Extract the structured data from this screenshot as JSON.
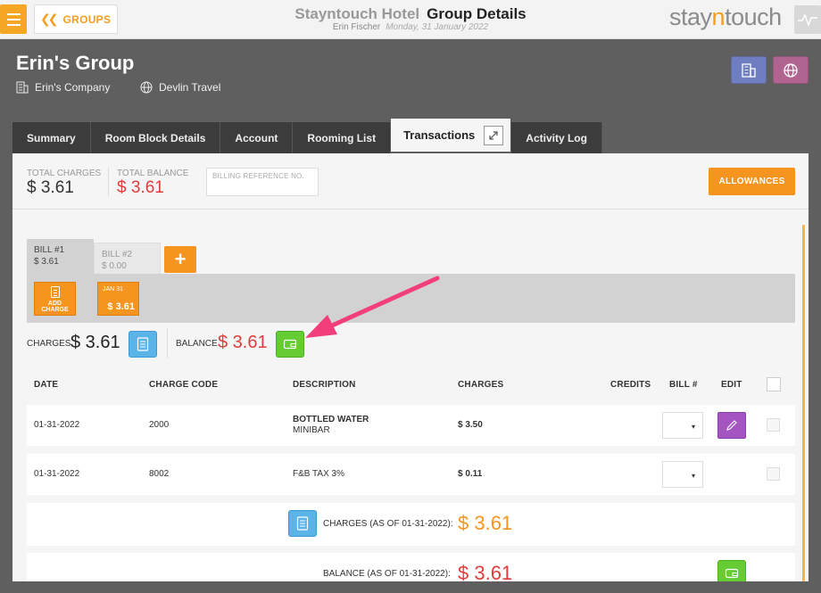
{
  "topbar": {
    "menu_icon": "hamburger-icon",
    "back_label": "GROUPS",
    "hotel_name": "Stayntouch Hotel",
    "page_title": "Group Details",
    "user_name": "Erin Fischer",
    "business_date": "Monday, 31 January 2022",
    "logo_prefix": "stay",
    "logo_n": "n",
    "logo_suffix": "touch"
  },
  "group": {
    "name": "Erin's Group",
    "company": "Erin's Company",
    "travel_agent": "Devlin Travel"
  },
  "tabs": [
    {
      "label": "Summary"
    },
    {
      "label": "Room Block Details"
    },
    {
      "label": "Account"
    },
    {
      "label": "Rooming List"
    },
    {
      "label": "Transactions",
      "active": true
    },
    {
      "label": "Activity Log"
    }
  ],
  "totals": {
    "total_charges_label": "TOTAL CHARGES",
    "total_charges_value": "$ 3.61",
    "total_balance_label": "TOTAL BALANCE",
    "total_balance_value": "$ 3.61",
    "billing_ref_placeholder": "BILLING REFERENCE NO.",
    "allowances_label": "ALLOWANCES"
  },
  "bills": [
    {
      "label": "BILL #1",
      "amount": "$ 3.61",
      "active": true
    },
    {
      "label": "BILL #2",
      "amount": "$ 0.00",
      "active": false
    }
  ],
  "add_bill_label": "+",
  "add_charge_label": "ADD CHARGE",
  "date_card": {
    "date": "JAN 31",
    "amount": "$ 3.61"
  },
  "summary": {
    "charges_label": "CHARGES",
    "charges_value": "$ 3.61",
    "balance_label": "BALANCE",
    "balance_value": "$ 3.61"
  },
  "table": {
    "headers": {
      "date": "DATE",
      "charge_code": "CHARGE CODE",
      "description": "DESCRIPTION",
      "charges": "CHARGES",
      "credits": "CREDITS",
      "bill_no": "BILL #",
      "edit": "EDIT"
    },
    "rows": [
      {
        "date": "01-31-2022",
        "code": "2000",
        "description": "BOTTLED WATER",
        "sub": "MINIBAR",
        "charge": "$ 3.50",
        "select": "▾"
      },
      {
        "date": "01-31-2022",
        "code": "8002",
        "description": "F&B TAX 3%",
        "sub": "",
        "charge": "$ 0.11",
        "select": "▾"
      }
    ]
  },
  "footer": {
    "charges_label": "CHARGES (AS OF 01-31-2022):",
    "charges_value": "$ 3.61",
    "balance_label": "BALANCE (AS OF 01-31-2022):",
    "balance_value": "$ 3.61"
  },
  "colors": {
    "orange": "#f5941e",
    "red": "#e03c3c",
    "green": "#66cc33",
    "blue": "#5ab4e8",
    "purple": "#a455c2",
    "arrow": "#f23e7a"
  }
}
